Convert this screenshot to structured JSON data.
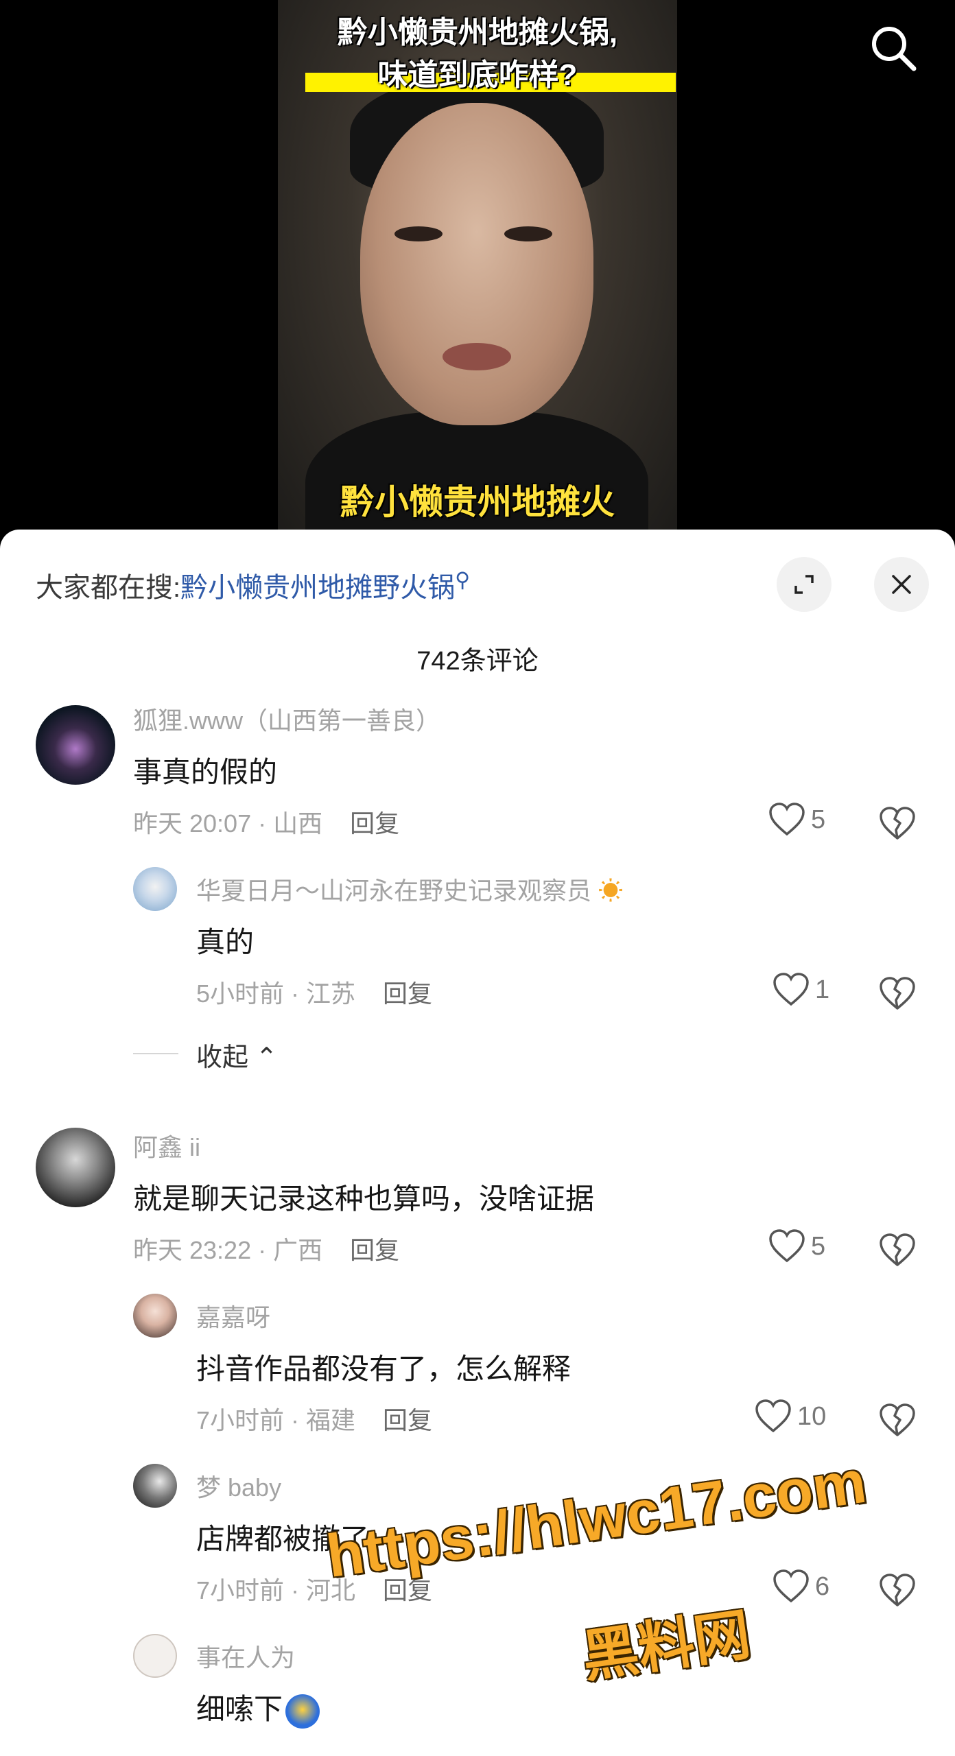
{
  "video": {
    "title_line1": "黔小懒贵州地摊火锅,",
    "title_line2": "味道到底咋样?",
    "subtitle": "黔小懒贵州地摊火",
    "search_icon": "search-icon"
  },
  "sheet": {
    "hot_search_prefix": "大家都在搜:",
    "hot_search_link": "黔小懒贵州地摊野火锅",
    "comment_count": "742条评论",
    "collapse_label": "收起"
  },
  "comments": [
    {
      "user": "狐狸.www（山西第一善良）",
      "text": "事真的假的",
      "time_loc": "昨天 20:07 · 山西",
      "reply_label": "回复",
      "likes": "5",
      "replies": [
        {
          "user": "华夏日月～山河永在野史记录观察员",
          "text": "真的",
          "time_loc": "5小时前 · 江苏",
          "reply_label": "回复",
          "likes": "1"
        }
      ]
    },
    {
      "user": "阿鑫 ii",
      "text": "就是聊天记录这种也算吗，没啥证据",
      "time_loc": "昨天 23:22 · 广西",
      "reply_label": "回复",
      "likes": "5",
      "replies": [
        {
          "user": "嘉嘉呀",
          "text": "抖音作品都没有了，怎么解释",
          "time_loc": "7小时前 · 福建",
          "reply_label": "回复",
          "likes": "10"
        },
        {
          "user": "梦 baby",
          "text": "店牌都被撤了",
          "time_loc": "7小时前 · 河北",
          "reply_label": "回复",
          "likes": "6"
        },
        {
          "user": "事在人为",
          "text": "细嗦下",
          "time_loc": "",
          "reply_label": "",
          "likes": ""
        }
      ]
    }
  ],
  "watermark": {
    "url": "https://hlwc17.com",
    "name": "黑料网"
  },
  "colors": {
    "link": "#2f5aa8",
    "meta": "#a3a3a3",
    "watermark": "#f7a928",
    "caption_yellow": "#ffe23d"
  }
}
